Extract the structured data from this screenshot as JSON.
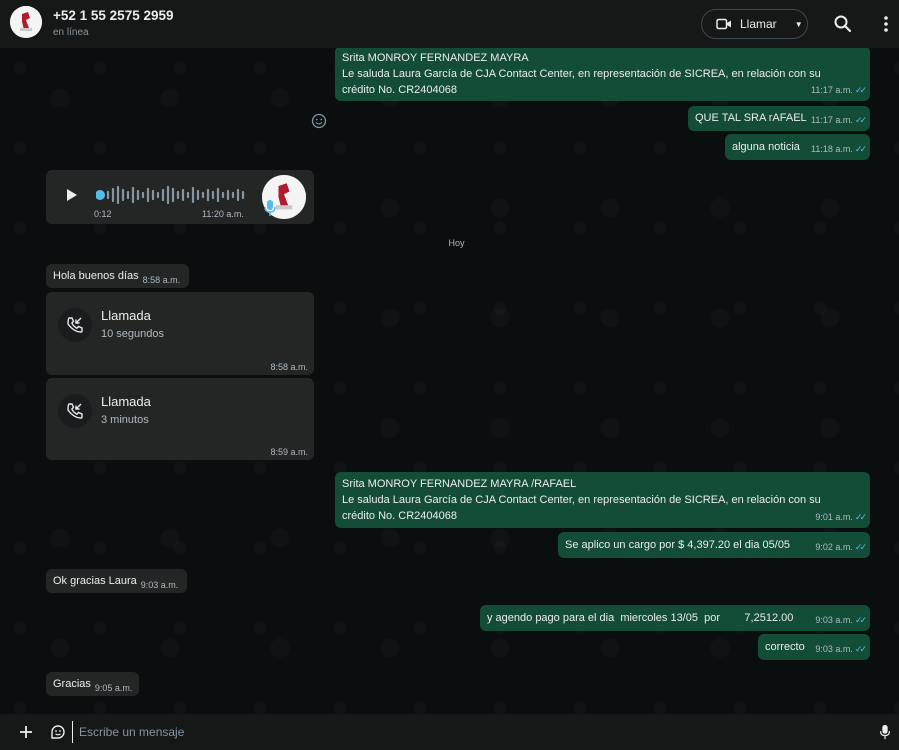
{
  "header": {
    "contact_name": "+52 1 55 2575 2959",
    "status": "en línea",
    "call_label": "Llamar",
    "icons": [
      "video-icon",
      "chevron-down-icon",
      "search-icon",
      "menu-icon"
    ]
  },
  "messages": {
    "m1": {
      "line1": "Srita  MONROY FERNANDEZ MAYRA",
      "line2": "Le saluda Laura García de CJA Contact Center, en representación de SICREA, en relación con su",
      "line3": "crédito No. CR2404068",
      "time": "11:17 a.m."
    },
    "m2": {
      "text": "QUE TAL SRA rAFAEL",
      "time": "11:17 a.m."
    },
    "m3": {
      "text": "alguna noticia",
      "time": "11:18 a.m."
    },
    "voice": {
      "duration": "0:12",
      "time": "11:20 a.m."
    },
    "day": "Hoy",
    "m4": {
      "text": "Hola buenos días",
      "time": "8:58 a.m."
    },
    "call1": {
      "title": "Llamada",
      "subtitle": "10 segundos",
      "time": "8:58 a.m."
    },
    "call2": {
      "title": "Llamada",
      "subtitle": "3 minutos",
      "time": "8:59 a.m."
    },
    "m5": {
      "line1": "Srita  MONROY FERNANDEZ MAYRA /RAFAEL",
      "line2": "Le saluda Laura García de CJA Contact Center, en representación de SICREA, en relación con su",
      "line3": "crédito No. CR2404068",
      "time": "9:01 a.m."
    },
    "m6": {
      "text": "Se aplico un cargo por  $ 4,397.20  el dia  05/05",
      "time": "9:02 a.m."
    },
    "m7": {
      "text": "Ok gracias Laura",
      "time": "9:03 a.m."
    },
    "m8": {
      "text": "y agendo pago para el dia  miercoles 13/05  por        7,2512.00",
      "time": "9:03 a.m."
    },
    "m9": {
      "text": "correcto",
      "time": "9:03 a.m."
    },
    "m10": {
      "text": "Gracias",
      "time": "9:05 a.m."
    }
  },
  "composer": {
    "placeholder": "Escribe un mensaje",
    "icons": [
      "plus-icon",
      "sticker-icon",
      "mic-icon"
    ]
  },
  "colors": {
    "outgoing_bubble": "#144d37",
    "incoming_bubble": "#242626",
    "read_tick": "#53bdeb",
    "background": "#0b0e0f"
  }
}
